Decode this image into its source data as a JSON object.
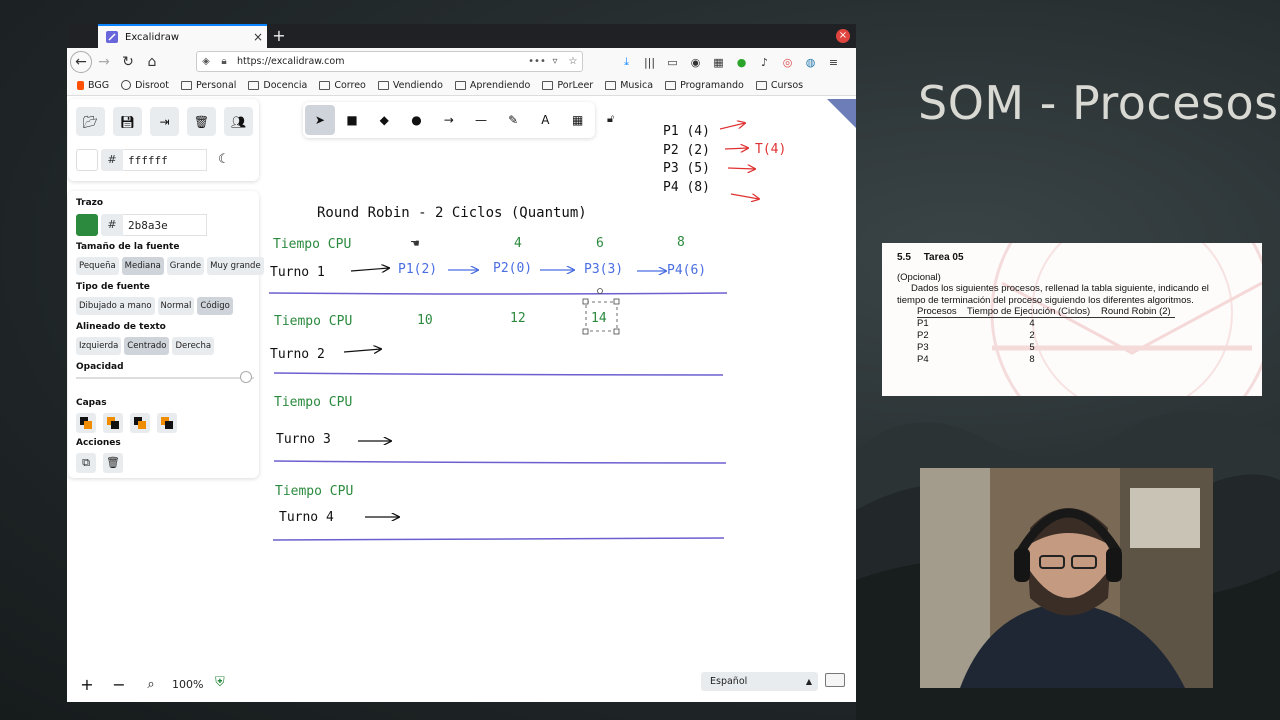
{
  "slide": {
    "title": "SOM - Procesos"
  },
  "document": {
    "section_number": "5.5",
    "section_title": "Tarea 05",
    "optional_label": "(Opcional)",
    "paragraph": "Dados los siguientes procesos, rellenad la tabla siguiente, indicando el tiempo de terminación del proceso siguiendo los diferentes algoritmos.",
    "table_headers": [
      "Procesos",
      "Tiempo de Ejecución (Ciclos)",
      "Round Robin (2)"
    ],
    "table_rows": [
      {
        "process": "P1",
        "time": "4",
        "rr": ""
      },
      {
        "process": "P2",
        "time": "2",
        "rr": ""
      },
      {
        "process": "P3",
        "time": "5",
        "rr": ""
      },
      {
        "process": "P4",
        "time": "8",
        "rr": ""
      }
    ]
  },
  "browser": {
    "tab_title": "Excalidraw",
    "new_tab_label": "+",
    "close_window_label": "×",
    "url": "https://excalidraw.com",
    "url_actions_label": "•••",
    "bookmarks": [
      "BGG",
      "Disroot",
      "Personal",
      "Docencia",
      "Correo",
      "Vendiendo",
      "Aprendiendo",
      "PorLeer",
      "Musica",
      "Programando",
      "Cursos"
    ]
  },
  "excalidraw": {
    "background_hex": "ffffff",
    "sections": {
      "stroke": "Trazo",
      "font_size": "Tamaño de la fuente",
      "font_family": "Tipo de fuente",
      "text_align": "Alineado de texto",
      "opacity": "Opacidad",
      "layers": "Capas",
      "actions": "Acciones"
    },
    "stroke_hex": "2b8a3e",
    "font_sizes": [
      "Pequeña",
      "Mediana",
      "Grande",
      "Muy grande"
    ],
    "font_size_selected": "Mediana",
    "font_families": [
      "Dibujado a mano",
      "Normal",
      "Código"
    ],
    "font_family_selected": "Código",
    "text_aligns": [
      "Izquierda",
      "Centrado",
      "Derecha"
    ],
    "text_align_selected": "Centrado",
    "opacity_value": 1.0,
    "zoom": "100%",
    "language": "Español",
    "colors": {
      "green": "#2b8a3e",
      "blue": "#4a6ee0",
      "red": "#e03131",
      "divider": "#6c5fd0"
    }
  },
  "drawing": {
    "title": "Round Robin - 2 Ciclos (Quantum)",
    "processes": [
      "P1 (4)",
      "P2 (2)",
      "P3 (5)",
      "P4 (8)"
    ],
    "p2_result": "T(4)",
    "row1": {
      "cpu_label": "Tiempo CPU",
      "turn_label": "Turno 1",
      "times": [
        "4",
        "6",
        "8"
      ],
      "steps": [
        "P1(2)",
        "P2(0)",
        "P3(3)",
        "P4(6)"
      ]
    },
    "row2": {
      "cpu_label": "Tiempo CPU",
      "turn_label": "Turno 2",
      "times": [
        "10",
        "12",
        "14"
      ]
    },
    "row3": {
      "cpu_label": "Tiempo CPU",
      "turn_label": "Turno 3"
    },
    "row4": {
      "cpu_label": "Tiempo CPU",
      "turn_label": "Turno 4"
    }
  }
}
